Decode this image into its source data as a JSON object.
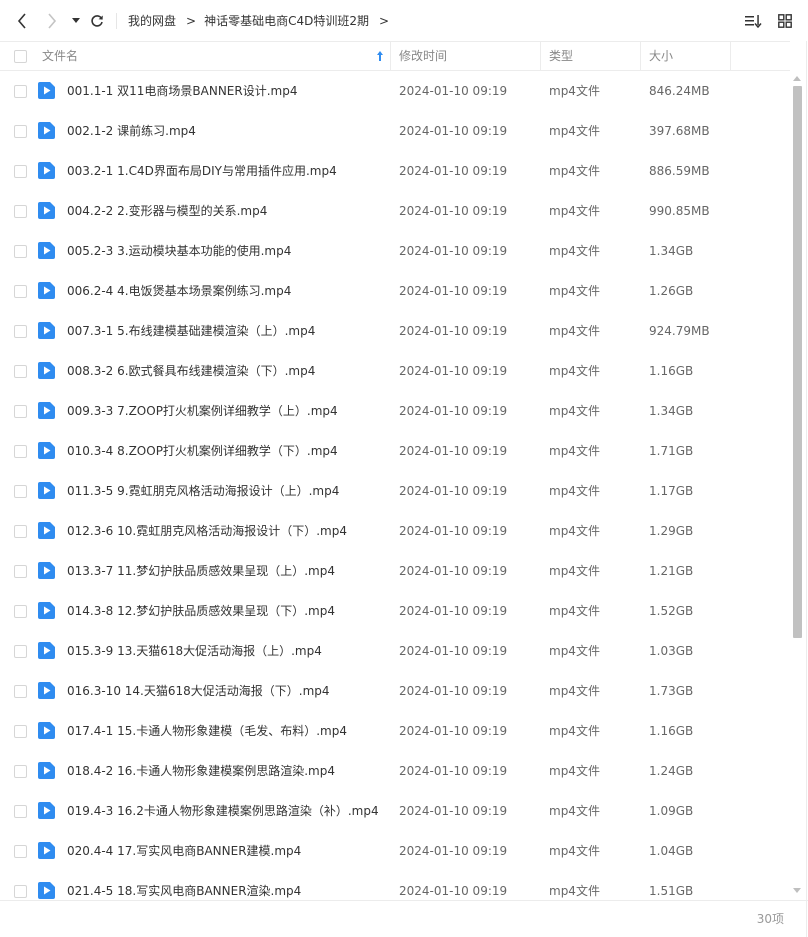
{
  "toolbar": {
    "back_icon": "chevron-left-icon",
    "forward_icon": "chevron-right-icon",
    "history_icon": "caret-down-icon",
    "refresh_icon": "refresh-icon",
    "breadcrumb": [
      "我的网盘",
      "神话零基础电商C4D特训班2期"
    ],
    "breadcrumb_separator": ">",
    "sort_icon": "sort-list-icon",
    "view_icon": "grid-view-icon"
  },
  "table": {
    "columns": {
      "name": "文件名",
      "mtime": "修改时间",
      "type": "类型",
      "size": "大小"
    },
    "sort_icon": "sort-ascending-arrow-icon",
    "rows": [
      {
        "name": "001.1-1 双11电商场景BANNER设计.mp4",
        "mtime": "2024-01-10 09:19",
        "type": "mp4文件",
        "size": "846.24MB"
      },
      {
        "name": "002.1-2 课前练习.mp4",
        "mtime": "2024-01-10 09:19",
        "type": "mp4文件",
        "size": "397.68MB"
      },
      {
        "name": "003.2-1 1.C4D界面布局DIY与常用插件应用.mp4",
        "mtime": "2024-01-10 09:19",
        "type": "mp4文件",
        "size": "886.59MB"
      },
      {
        "name": "004.2-2 2.变形器与模型的关系.mp4",
        "mtime": "2024-01-10 09:19",
        "type": "mp4文件",
        "size": "990.85MB"
      },
      {
        "name": "005.2-3 3.运动模块基本功能的使用.mp4",
        "mtime": "2024-01-10 09:19",
        "type": "mp4文件",
        "size": "1.34GB"
      },
      {
        "name": "006.2-4 4.电饭煲基本场景案例练习.mp4",
        "mtime": "2024-01-10 09:19",
        "type": "mp4文件",
        "size": "1.26GB"
      },
      {
        "name": "007.3-1 5.布线建模基础建模渲染（上）.mp4",
        "mtime": "2024-01-10 09:19",
        "type": "mp4文件",
        "size": "924.79MB"
      },
      {
        "name": "008.3-2 6.欧式餐具布线建模渲染（下）.mp4",
        "mtime": "2024-01-10 09:19",
        "type": "mp4文件",
        "size": "1.16GB"
      },
      {
        "name": "009.3-3 7.ZOOP打火机案例详细教学（上）.mp4",
        "mtime": "2024-01-10 09:19",
        "type": "mp4文件",
        "size": "1.34GB"
      },
      {
        "name": "010.3-4 8.ZOOP打火机案例详细教学（下）.mp4",
        "mtime": "2024-01-10 09:19",
        "type": "mp4文件",
        "size": "1.71GB"
      },
      {
        "name": "011.3-5 9.霓虹朋克风格活动海报设计（上）.mp4",
        "mtime": "2024-01-10 09:19",
        "type": "mp4文件",
        "size": "1.17GB"
      },
      {
        "name": "012.3-6 10.霓虹朋克风格活动海报设计（下）.mp4",
        "mtime": "2024-01-10 09:19",
        "type": "mp4文件",
        "size": "1.29GB"
      },
      {
        "name": "013.3-7 11.梦幻护肤品质感效果呈现（上）.mp4",
        "mtime": "2024-01-10 09:19",
        "type": "mp4文件",
        "size": "1.21GB"
      },
      {
        "name": "014.3-8 12.梦幻护肤品质感效果呈现（下）.mp4",
        "mtime": "2024-01-10 09:19",
        "type": "mp4文件",
        "size": "1.52GB"
      },
      {
        "name": "015.3-9 13.天猫618大促活动海报（上）.mp4",
        "mtime": "2024-01-10 09:19",
        "type": "mp4文件",
        "size": "1.03GB"
      },
      {
        "name": "016.3-10 14.天猫618大促活动海报（下）.mp4",
        "mtime": "2024-01-10 09:19",
        "type": "mp4文件",
        "size": "1.73GB"
      },
      {
        "name": "017.4-1 15.卡通人物形象建模（毛发、布料）.mp4",
        "mtime": "2024-01-10 09:19",
        "type": "mp4文件",
        "size": "1.16GB"
      },
      {
        "name": "018.4-2 16.卡通人物形象建模案例思路渲染.mp4",
        "mtime": "2024-01-10 09:19",
        "type": "mp4文件",
        "size": "1.24GB"
      },
      {
        "name": "019.4-3 16.2卡通人物形象建模案例思路渲染（补）.mp4",
        "mtime": "2024-01-10 09:19",
        "type": "mp4文件",
        "size": "1.09GB"
      },
      {
        "name": "020.4-4 17.写实风电商BANNER建模.mp4",
        "mtime": "2024-01-10 09:19",
        "type": "mp4文件",
        "size": "1.04GB"
      },
      {
        "name": "021.4-5 18.写实风电商BANNER渲染.mp4",
        "mtime": "2024-01-10 09:19",
        "type": "mp4文件",
        "size": "1.51GB"
      }
    ],
    "file_icon": "video-file-icon"
  },
  "footer": {
    "count": "30项"
  },
  "colors": {
    "accent": "#2f8cf0",
    "text": "#333333",
    "muted": "#888888",
    "border": "#ececec"
  }
}
